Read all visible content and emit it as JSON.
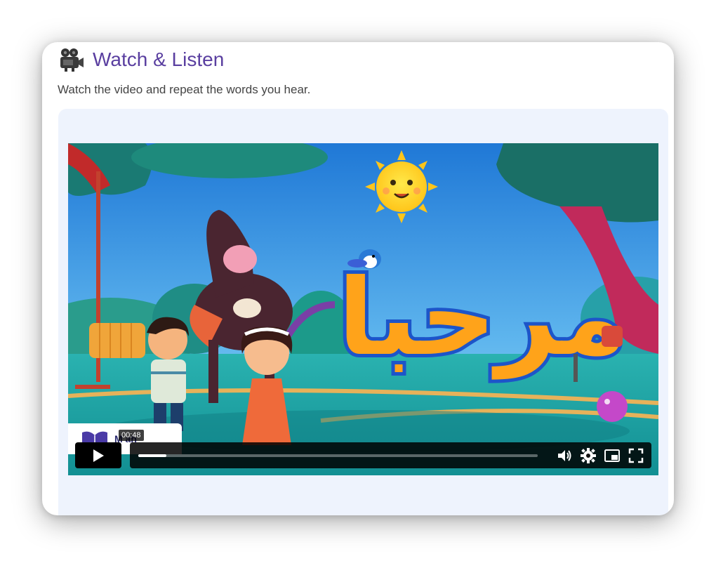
{
  "header": {
    "icon": "movie-camera-icon",
    "title": "Watch & Listen",
    "subtitle": "Watch the video and repeat the words you hear."
  },
  "video": {
    "title_art_text": "مرحبا",
    "logo_text": "M       ah",
    "hover_time": "00:48",
    "progress_fraction": 0.07,
    "controls": [
      "play-icon",
      "volume-icon",
      "settings-icon",
      "picture-in-picture-icon",
      "fullscreen-icon"
    ]
  },
  "colors": {
    "title": "#5a3fa0",
    "panel": "#eef3fd",
    "title_art_fill": "#ffa31a",
    "title_art_outline": "#1d55c9"
  }
}
